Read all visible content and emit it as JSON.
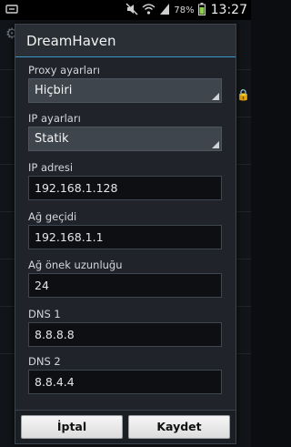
{
  "status_bar": {
    "battery": "78%",
    "time": "13:27",
    "icons": [
      "notification-icon",
      "mute-icon",
      "wifi-icon",
      "signal-icon",
      "battery-icon"
    ]
  },
  "dialog": {
    "title": "DreamHaven",
    "proxy": {
      "label": "Proxy ayarları",
      "value": "Hiçbiri"
    },
    "ip_settings": {
      "label": "IP ayarları",
      "value": "Statik"
    },
    "ip_address": {
      "label": "IP adresi",
      "value": "192.168.1.128"
    },
    "gateway": {
      "label": "Ağ geçidi",
      "value": "192.168.1.1"
    },
    "prefix_length": {
      "label": "Ağ önek uzunluğu",
      "value": "24"
    },
    "dns1": {
      "label": "DNS 1",
      "value": "8.8.8.8"
    },
    "dns2": {
      "label": "DNS 2",
      "value": "8.8.4.4"
    },
    "buttons": {
      "cancel": "İptal",
      "save": "Kaydet"
    }
  },
  "colors": {
    "accent": "#3a97c7",
    "dialog_bg": "#20242a",
    "field_bg": "#0d0f12"
  }
}
